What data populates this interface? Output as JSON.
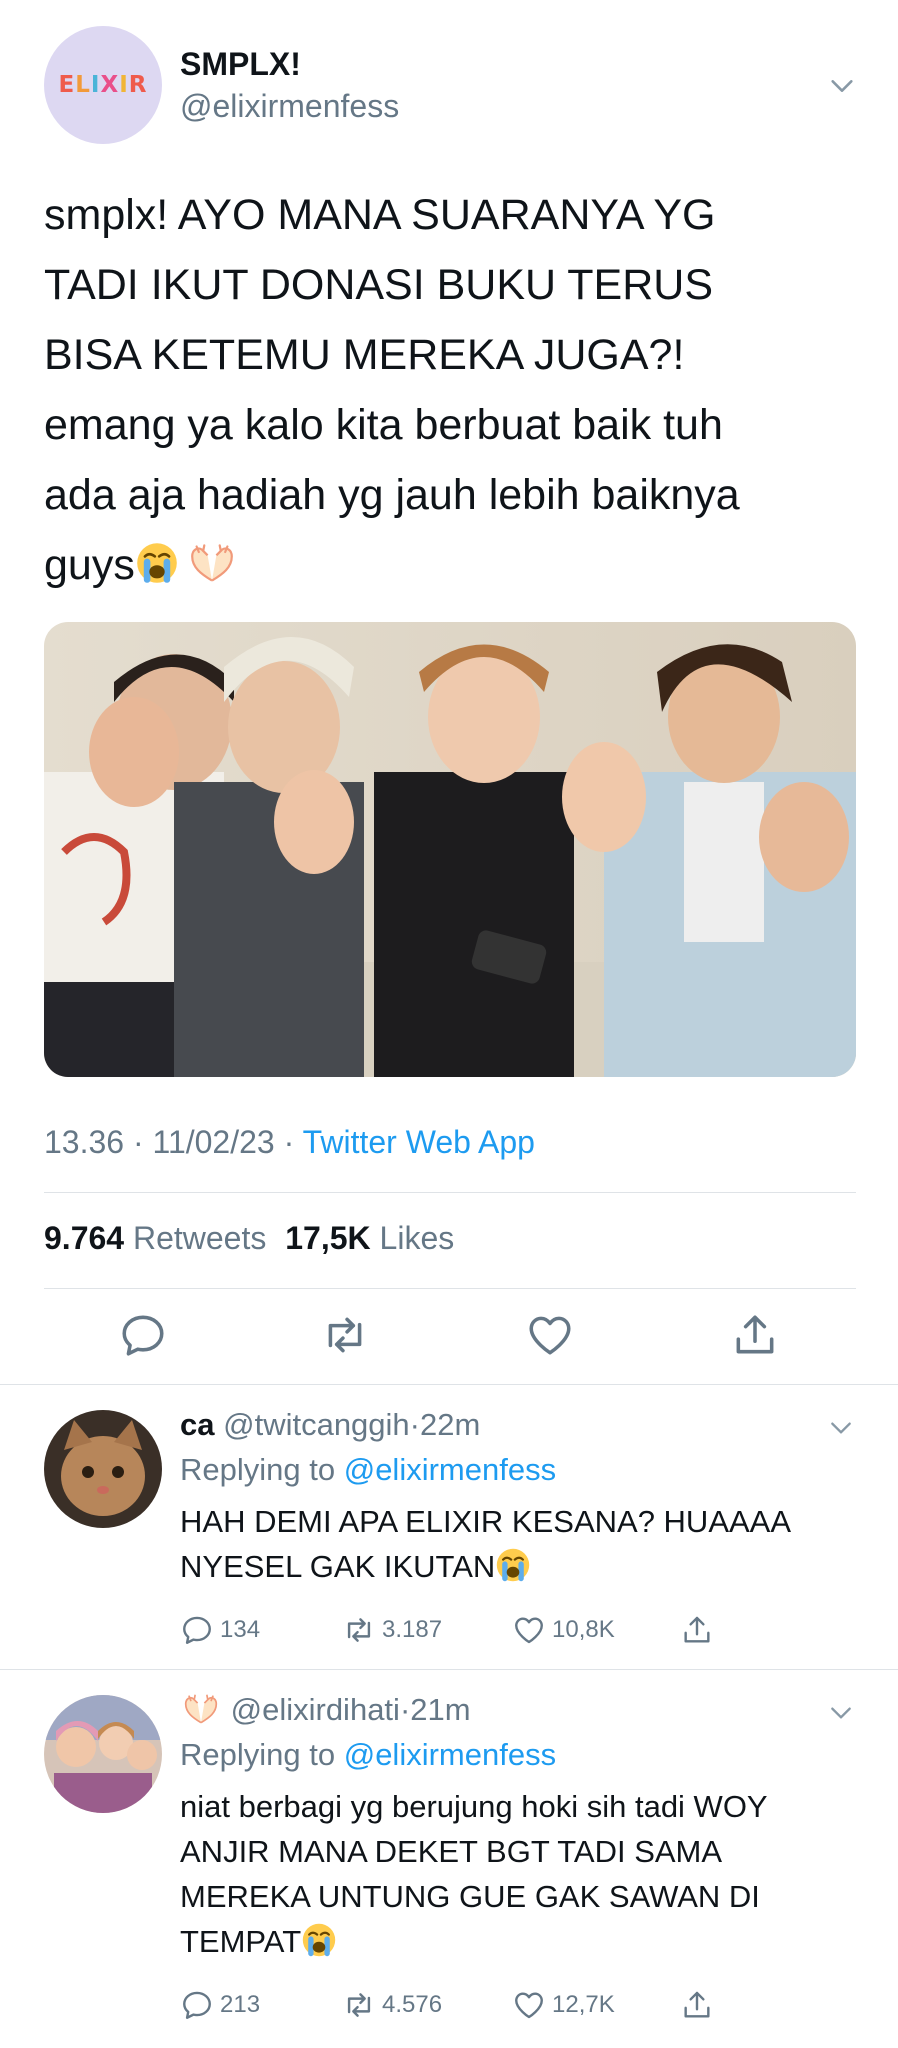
{
  "tweet": {
    "avatar_logo_text": "ELIXIR",
    "display_name": "SMPLX!",
    "handle": "@elixirmenfess",
    "text_lines": [
      "smplx! AYO MANA SUARANYA YG",
      "TADI IKUT DONASI BUKU TERUS",
      "BISA KETEMU MEREKA JUGA?!",
      "emang ya kalo kita berbuat baik tuh",
      "ada aja hadiah yg jauh lebih baiknya",
      "guys"
    ],
    "time": "13.36",
    "date": "11/02/23",
    "separator": "·",
    "source": "Twitter Web App",
    "retweets_count": "9.764",
    "retweets_label": "Retweets",
    "likes_count": "17,5K",
    "likes_label": "Likes"
  },
  "replies": [
    {
      "name": "ca",
      "handle": "@twitcanggih",
      "separator": "·",
      "time": "22m",
      "replying_prefix": "Replying to",
      "replying_to": "@elixirmenfess",
      "text_lines": [
        "HAH DEMI APA ELIXIR KESANA? HUAAAA",
        "NYESEL GAK IKUTAN"
      ],
      "reply_count": "134",
      "retweet_count": "3.187",
      "like_count": "10,8K"
    },
    {
      "name": "",
      "handle": "@elixirdihati",
      "separator": "·",
      "time": "21m",
      "replying_prefix": "Replying to",
      "replying_to": "@elixirmenfess",
      "text_lines": [
        "niat berbagi yg berujung hoki sih tadi WOY",
        "ANJIR MANA DEKET BGT TADI SAMA",
        "MEREKA UNTUNG GUE GAK SAWAN DI",
        "TEMPAT"
      ],
      "reply_count": "213",
      "retweet_count": "4.576",
      "like_count": "12,7K"
    }
  ],
  "colors": {
    "link": "#1d9bf0",
    "muted": "#657786",
    "avatar_bg": "#ddd8f2"
  }
}
